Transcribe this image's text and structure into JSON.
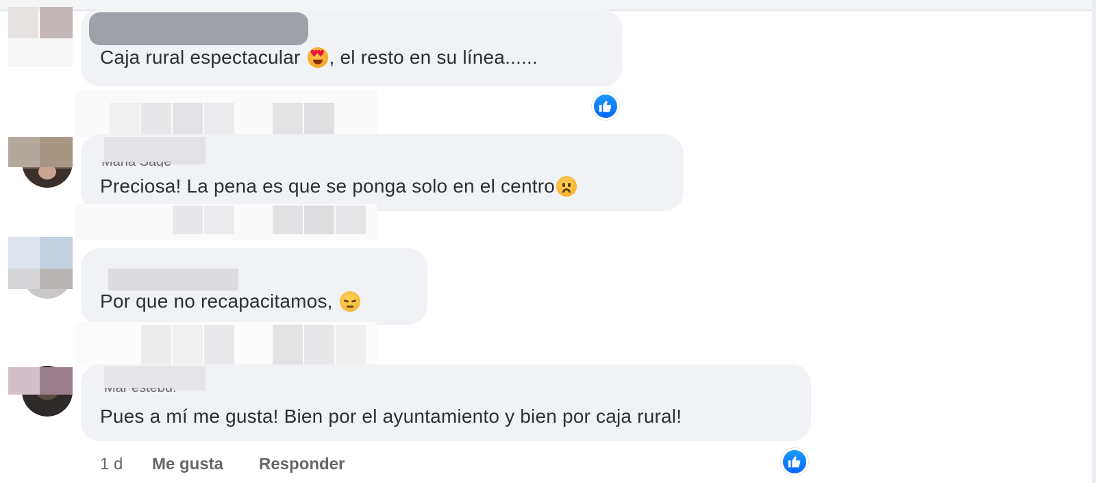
{
  "comments": [
    {
      "text": "Caja rural espectacular",
      "text_after": ", el resto en su línea......",
      "emoji": "smiling-face-with-heart-eyes"
    },
    {
      "author_fragment": "Maria Sage",
      "text": "Preciosa! La pena es que se ponga solo en el centro",
      "emoji": "worried-face"
    },
    {
      "text": "Por que no recapacitamos,",
      "emoji": "pensive-face"
    },
    {
      "author_fragment": "Mar estebu.",
      "text": "Pues a mí me gusta! Bien por el ayuntamiento y bien por caja rural!"
    }
  ],
  "actions": {
    "time": "1 d",
    "like_label": "Me gusta",
    "reply_label": "Responder"
  },
  "icons": {
    "reaction": "like-thumbs-up-icon"
  },
  "colors": {
    "bubble": "#f0f2f5",
    "like_blue": "#0866ff",
    "meta_gray": "#65676b"
  }
}
